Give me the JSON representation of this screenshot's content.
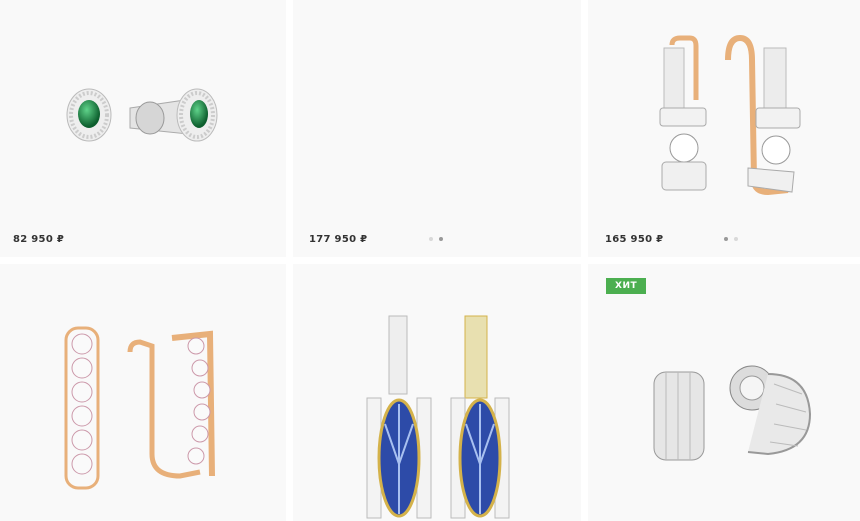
{
  "products": [
    {
      "price": "82 950 ₽",
      "image": "emerald-halo-stud-earrings"
    },
    {
      "price": "177 950 ₽",
      "image": "empty",
      "dots": 2,
      "active_dot": 1
    },
    {
      "price": "165 950 ₽",
      "image": "diamond-bypass-earrings",
      "dots": 2,
      "active_dot": 0
    },
    {
      "price": "",
      "image": "rose-gold-diamond-hoops"
    },
    {
      "price": "",
      "image": "blue-enamel-drop-earrings"
    },
    {
      "price": "",
      "image": "silver-ribbed-half-hoops",
      "badge": "ХИТ"
    }
  ],
  "colors": {
    "card_bg": "#f9f9f9",
    "badge_bg": "#4caf50",
    "price_text": "#333333",
    "gold": "#e8b07a",
    "emerald": "#1a8a46",
    "enamel_blue": "#2d4ba8"
  }
}
